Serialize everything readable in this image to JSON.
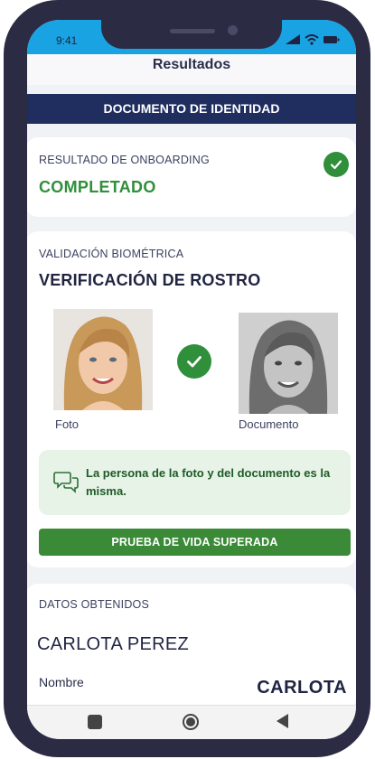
{
  "status_bar": {
    "time": "9:41"
  },
  "header": {
    "title": "Resultados"
  },
  "document_banner": {
    "label": "DOCUMENTO DE IDENTIDAD"
  },
  "onboarding": {
    "label": "RESULTADO DE ONBOARDING",
    "status": "COMPLETADO",
    "status_color": "#2f8f3b"
  },
  "biometric": {
    "label": "VALIDACIÓN BIOMÉTRICA",
    "title": "VERIFICACIÓN DE ROSTRO",
    "photo_caption": "Foto",
    "document_caption": "Documento",
    "match_message": "La persona de la foto y del documento es la misma.",
    "liveness_button": "PRUEBA DE VIDA SUPERADA"
  },
  "data_obtained": {
    "label": "DATOS OBTENIDOS",
    "full_name": "CARLOTA PEREZ",
    "fields": [
      {
        "label": "Nombre",
        "value": "CARLOTA"
      }
    ]
  },
  "nav_bar": {
    "icons": [
      "square-recents-icon",
      "circle-home-icon",
      "triangle-back-icon"
    ]
  },
  "colors": {
    "accent": "#1aa3e2",
    "banner": "#1f2e5e",
    "success": "#2f8f3b"
  }
}
